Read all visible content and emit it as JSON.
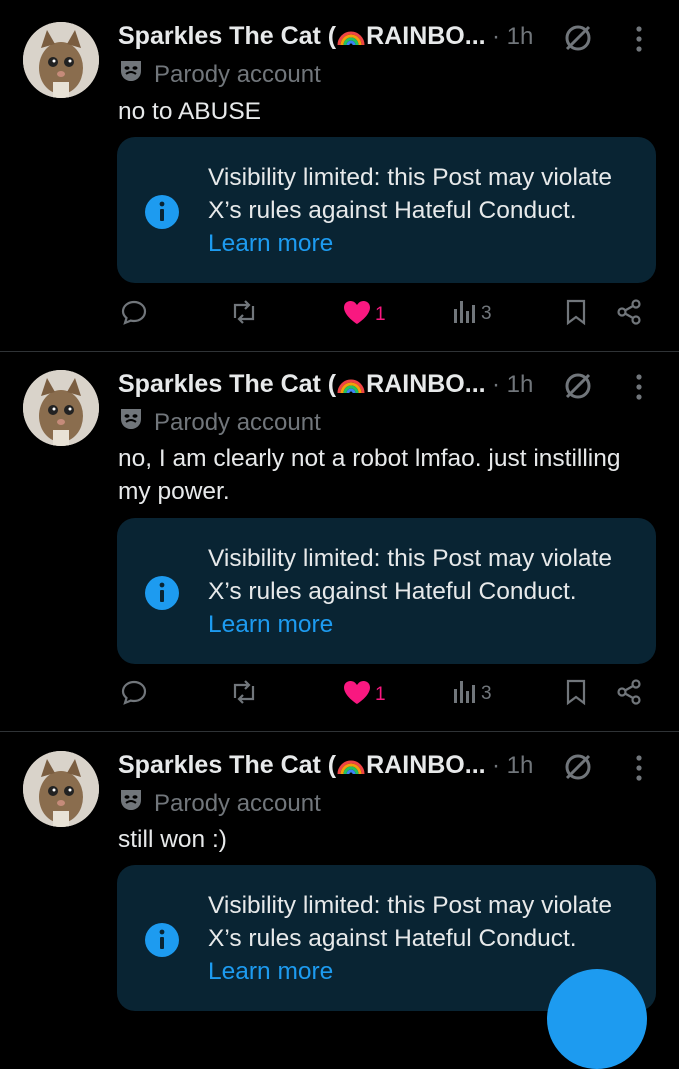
{
  "posts": [
    {
      "author": "Sparkles The Cat (",
      "author_suffix": "RAINBO...",
      "time": "· 1h",
      "badge": "Parody account",
      "text": "no to ABUSE",
      "notice": {
        "text": "Visibility limited: this Post may violate X’s rules against Hateful Conduct.",
        "link": "Learn more"
      },
      "likes": "1",
      "views": "3"
    },
    {
      "author": "Sparkles The Cat (",
      "author_suffix": "RAINBO...",
      "time": "· 1h",
      "badge": "Parody account",
      "text": "no, I am clearly not a robot lmfao. just instilling my power.",
      "notice": {
        "text": "Visibility limited: this Post may violate X’s rules against Hateful Conduct.",
        "link": "Learn more"
      },
      "likes": "1",
      "views": "3"
    },
    {
      "author": "Sparkles The Cat (",
      "author_suffix": "RAINBO...",
      "time": "· 1h",
      "badge": "Parody account",
      "text": "still won :)",
      "notice": {
        "text": "Visibility limited: this Post may violate X’s rules against Hateful Conduct.",
        "link": "Learn more"
      }
    }
  ],
  "icons": {
    "reply": "reply-icon",
    "repost": "repost-icon",
    "like": "heart-filled-icon",
    "views": "views-icon",
    "bookmark": "bookmark-icon",
    "share": "share-icon",
    "muted": "muted-icon",
    "more": "more-vertical-icon",
    "info": "info-icon",
    "parody": "theater-mask-icon"
  },
  "colors": {
    "background": "#000000",
    "text": "#e7e9ea",
    "muted": "#71767b",
    "accent": "#1d9bf0",
    "like": "#f91880",
    "notice_bg": "#092433"
  }
}
